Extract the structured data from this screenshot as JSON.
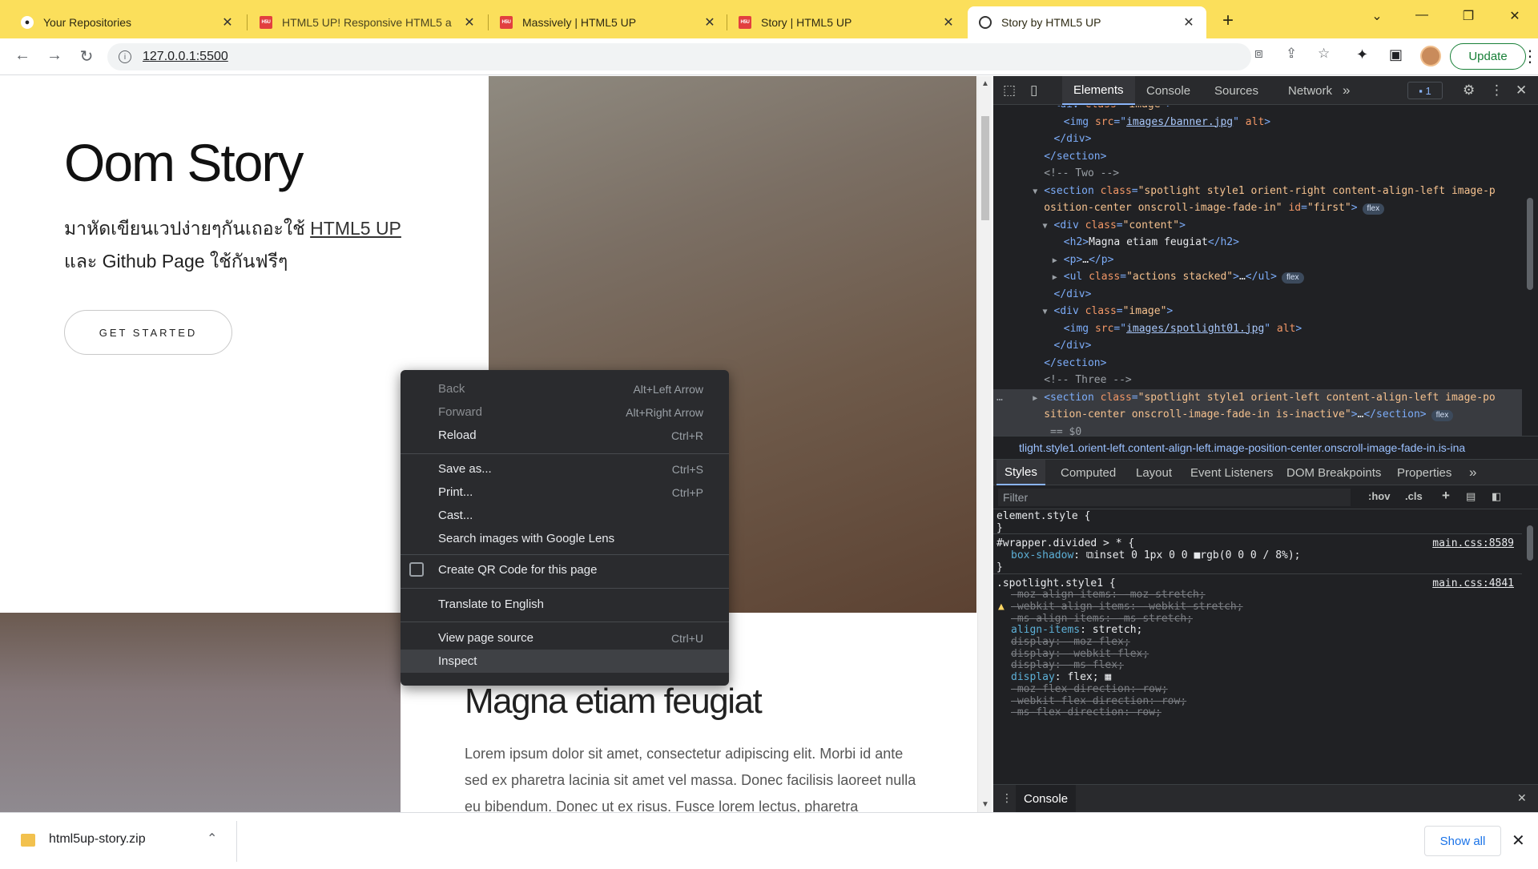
{
  "tabs": [
    {
      "title": "Your Repositories",
      "icon": "github-icon"
    },
    {
      "title": "HTML5 UP! Responsive HTML5 a",
      "icon": "html5up-icon"
    },
    {
      "title": "Massively | HTML5 UP",
      "icon": "html5up-icon"
    },
    {
      "title": "Story | HTML5 UP",
      "icon": "html5up-icon"
    },
    {
      "title": "Story by HTML5 UP",
      "icon": "globe-icon",
      "active": true
    }
  ],
  "toolbar": {
    "url": "127.0.0.1:5500",
    "update_label": "Update"
  },
  "page": {
    "hero_title": "Oom Story",
    "hero_text_1": "มาหัดเขียนเวปง่ายๆกันเถอะใช้ ",
    "hero_link": "HTML5 UP",
    "hero_text_2": "และ Github Page ใช้กันฟรีๆ",
    "get_started": "GET STARTED",
    "section_title": "Magna etiam feugiat",
    "section_paragraph": "Lorem ipsum dolor sit amet, consectetur adipiscing elit. Morbi id ante sed ex pharetra lacinia sit amet vel massa. Donec facilisis laoreet nulla eu bibendum. Donec ut ex risus. Fusce lorem lectus, pharetra"
  },
  "context_menu": {
    "items": [
      {
        "label": "Back",
        "shortcut": "Alt+Left Arrow",
        "disabled": true
      },
      {
        "label": "Forward",
        "shortcut": "Alt+Right Arrow",
        "disabled": true
      },
      {
        "label": "Reload",
        "shortcut": "Ctrl+R"
      },
      {
        "label": "Save as...",
        "shortcut": "Ctrl+S"
      },
      {
        "label": "Print...",
        "shortcut": "Ctrl+P"
      },
      {
        "label": "Cast...",
        "shortcut": ""
      },
      {
        "label": "Search images with Google Lens",
        "shortcut": ""
      },
      {
        "label": "Create QR Code for this page",
        "shortcut": ""
      },
      {
        "label": "Translate to English",
        "shortcut": ""
      },
      {
        "label": "View page source",
        "shortcut": "Ctrl+U"
      },
      {
        "label": "Inspect",
        "shortcut": "",
        "highlighted": true
      }
    ]
  },
  "devtools": {
    "tabs": [
      "Elements",
      "Console",
      "Sources",
      "Network"
    ],
    "issues_count": "1",
    "breadcrumb": "tlight.style1.orient-left.content-align-left.image-position-center.onscroll-image-fade-in.is-ina",
    "styles_tabs": [
      "Styles",
      "Computed",
      "Layout",
      "Event Listeners",
      "DOM Breakpoints",
      "Properties"
    ],
    "filter_placeholder": "Filter",
    "hov": ":hov",
    "cls": ".cls",
    "drawer_tab": "Console",
    "dom_lines": [
      {
        "type": "raw",
        "indent": 5,
        "html": "<span class='tag'>&lt;div </span><span class='attr'>class</span><span class='tag'>=</span><span class='val'>\"image\"</span><span class='tag'>&gt;</span>"
      },
      {
        "indent": 6,
        "parts": [
          [
            "tag",
            "<img "
          ],
          [
            "attr",
            "src"
          ],
          [
            "tag",
            "=\""
          ],
          [
            "url",
            "images/banner.jpg"
          ],
          [
            "tag",
            "\" "
          ],
          [
            "attr",
            "alt"
          ],
          [
            "tag",
            ">"
          ]
        ]
      },
      {
        "indent": 5,
        "parts": [
          [
            "tag",
            "</div>"
          ]
        ]
      },
      {
        "indent": 4,
        "parts": [
          [
            "tag",
            "</section>"
          ]
        ]
      },
      {
        "indent": 4,
        "parts": [
          [
            "cmt",
            "<!-- Two -->"
          ]
        ]
      },
      {
        "indent": 4,
        "tri": "▼",
        "parts": [
          [
            "tag",
            "<section "
          ],
          [
            "attr",
            "class"
          ],
          [
            "tag",
            "="
          ],
          [
            "val",
            "\"spotlight style1 orient-right content-align-left image-p"
          ]
        ]
      },
      {
        "indent": 4,
        "parts": [
          [
            "val",
            "osition-center onscroll-image-fade-in\" "
          ],
          [
            "attr",
            "id"
          ],
          [
            "tag",
            "="
          ],
          [
            "val",
            "\"first\""
          ],
          [
            "tag",
            ">"
          ]
        ],
        "badge": "flex"
      },
      {
        "indent": 5,
        "tri": "▼",
        "parts": [
          [
            "tag",
            "<div "
          ],
          [
            "attr",
            "class"
          ],
          [
            "tag",
            "="
          ],
          [
            "val",
            "\"content\""
          ],
          [
            "tag",
            ">"
          ]
        ]
      },
      {
        "indent": 6,
        "parts": [
          [
            "tag",
            "<h2>"
          ],
          [
            "txt",
            "Magna etiam feugiat"
          ],
          [
            "tag",
            "</h2>"
          ]
        ]
      },
      {
        "indent": 6,
        "tri": "▶",
        "parts": [
          [
            "tag",
            "<p>"
          ],
          [
            "txt",
            "…"
          ],
          [
            "tag",
            "</p>"
          ]
        ]
      },
      {
        "indent": 6,
        "tri": "▶",
        "parts": [
          [
            "tag",
            "<ul "
          ],
          [
            "attr",
            "class"
          ],
          [
            "tag",
            "="
          ],
          [
            "val",
            "\"actions stacked\""
          ],
          [
            "tag",
            ">"
          ],
          [
            "txt",
            "…"
          ],
          [
            "tag",
            "</ul>"
          ]
        ],
        "badge": "flex"
      },
      {
        "indent": 5,
        "parts": [
          [
            "tag",
            "</div>"
          ]
        ]
      },
      {
        "indent": 5,
        "tri": "▼",
        "parts": [
          [
            "tag",
            "<div "
          ],
          [
            "attr",
            "class"
          ],
          [
            "tag",
            "="
          ],
          [
            "val",
            "\"image\""
          ],
          [
            "tag",
            ">"
          ]
        ]
      },
      {
        "indent": 6,
        "parts": [
          [
            "tag",
            "<img "
          ],
          [
            "attr",
            "src"
          ],
          [
            "tag",
            "=\""
          ],
          [
            "url",
            "images/spotlight01.jpg"
          ],
          [
            "tag",
            "\" "
          ],
          [
            "attr",
            "alt"
          ],
          [
            "tag",
            ">"
          ]
        ]
      },
      {
        "indent": 5,
        "parts": [
          [
            "tag",
            "</div>"
          ]
        ]
      },
      {
        "indent": 4,
        "parts": [
          [
            "tag",
            "</section>"
          ]
        ]
      },
      {
        "indent": 4,
        "parts": [
          [
            "cmt",
            "<!-- Three -->"
          ]
        ]
      },
      {
        "indent": 4,
        "tri": "▶",
        "sel": true,
        "parts": [
          [
            "tag",
            "<section "
          ],
          [
            "attr",
            "class"
          ],
          [
            "tag",
            "="
          ],
          [
            "val",
            "\"spotlight style1 orient-left content-align-left image-po"
          ]
        ]
      },
      {
        "indent": 4,
        "sel": true,
        "parts": [
          [
            "val",
            "sition-center onscroll-image-fade-in is-inactive\""
          ],
          [
            "tag",
            ">"
          ],
          [
            "txt",
            "…"
          ],
          [
            "tag",
            "</section>"
          ]
        ],
        "badge": "flex"
      },
      {
        "indent": 4,
        "sel": true,
        "parts": [
          [
            "cmt",
            " == $0"
          ]
        ]
      }
    ],
    "style_lines": [
      {
        "parts": [
          [
            "sel-txt",
            "element.style {"
          ]
        ]
      },
      {
        "parts": [
          [
            "sel-txt",
            "}"
          ]
        ]
      },
      {
        "sep": true
      },
      {
        "parts": [
          [
            "sel-txt",
            "#wrapper.divided > * {"
          ]
        ],
        "src": "main.css:8589"
      },
      {
        "indent": 1,
        "parts": [
          [
            "pn",
            "box-shadow"
          ],
          [
            "pv",
            ": ⧉inset 0 1px 0 0 ■rgb(0 0 0 / 8%);"
          ]
        ]
      },
      {
        "parts": [
          [
            "sel-txt",
            "}"
          ]
        ]
      },
      {
        "sep": true
      },
      {
        "parts": [
          [
            "sel-txt",
            ".spotlight.style1 {"
          ]
        ],
        "src": "main.css:4841"
      },
      {
        "indent": 1,
        "strike": true,
        "parts": [
          [
            "strike",
            "-moz-align-items: -moz-stretch;"
          ]
        ]
      },
      {
        "indent": 1,
        "warn": true,
        "parts": [
          [
            "strike",
            "-webkit-align-items: -webkit-stretch;"
          ]
        ]
      },
      {
        "indent": 1,
        "strike": true,
        "parts": [
          [
            "strike",
            "-ms-align-items: -ms-stretch;"
          ]
        ]
      },
      {
        "indent": 1,
        "parts": [
          [
            "pn",
            "align-items"
          ],
          [
            "pv",
            ": stretch;"
          ]
        ]
      },
      {
        "indent": 1,
        "parts": [
          [
            "strike",
            "display: -moz-flex;"
          ]
        ]
      },
      {
        "indent": 1,
        "parts": [
          [
            "strike",
            "display: -webkit-flex;"
          ]
        ]
      },
      {
        "indent": 1,
        "parts": [
          [
            "strike",
            "display: -ms-flex;"
          ]
        ]
      },
      {
        "indent": 1,
        "parts": [
          [
            "pn",
            "display"
          ],
          [
            "pv",
            ": flex; ▦"
          ]
        ]
      },
      {
        "indent": 1,
        "parts": [
          [
            "strike",
            "-moz-flex-direction: row;"
          ]
        ]
      },
      {
        "indent": 1,
        "parts": [
          [
            "strike",
            "-webkit-flex-direction: row;"
          ]
        ]
      },
      {
        "indent": 1,
        "parts": [
          [
            "strike",
            "-ms-flex-direction: row;"
          ]
        ]
      }
    ]
  },
  "download": {
    "filename": "html5up-story.zip",
    "show_all": "Show all"
  }
}
